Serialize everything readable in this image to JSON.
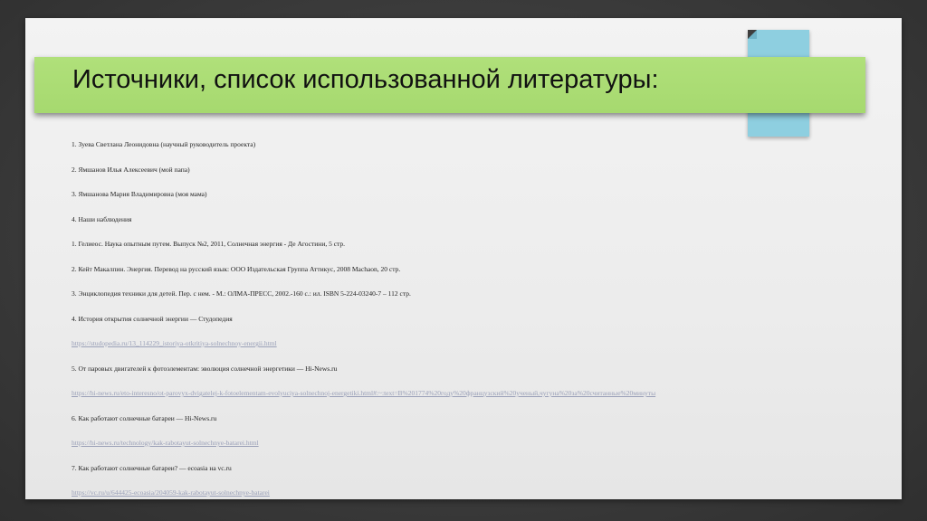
{
  "slide": {
    "title": "Источники, список использованной литературы:",
    "references": [
      {
        "text": "1. Зуева Светлана Леонидовна (научный руководитель проекта)",
        "kind": "text"
      },
      {
        "text": "2. Ямшанов Илья Алексеевич (мой папа)",
        "kind": "text"
      },
      {
        "text": "3. Ямшанова Мария Владимировна (моя мама)",
        "kind": "text"
      },
      {
        "text": "4. Наши наблюдения",
        "kind": "text"
      },
      {
        "text": "1. Гелиеос. Наука опытным путем. Выпуск №2, 2011, Солнечная энергия - Де Агостини, 5 стр.",
        "kind": "text"
      },
      {
        "text": "2. Кейт Макалпин. Энергия. Перевод на русский язык: ООО Издательская Группа Аттикус, 2008 Machaon, 20 стр.",
        "kind": "text"
      },
      {
        "text": "3. Энциклопедия техники для детей. Пер. с нем. - М.: ОЛМА-ПРЕСС, 2002.-160 с.: ил. ISBN 5-224-03240-7 – 112 стр.",
        "kind": "text"
      },
      {
        "text": "4. История открытия солнечной энергии — Студопедия",
        "kind": "text"
      },
      {
        "text": "https://studopedia.ru/13_114229_istoriya-otkritiya-solnechnoy-energii.html",
        "kind": "link"
      },
      {
        "text": "5. От паровых двигателей к фотоэлементам: эволюция солнечной энергетики — Hi-News.ru",
        "kind": "text"
      },
      {
        "text": "https://hi-news.ru/eto-interesno/ot-parovyx-dvigatelej-k-fotoelementam-evolyuciya-solnechnoj-energetiki.html#:~:text=B%201774%20году%20французский%20ученый,чугуна%20за%20считанные%20минуты",
        "kind": "link"
      },
      {
        "text": "6. Как работают солнечные батареи — Hi-News.ru",
        "kind": "text"
      },
      {
        "text": "https://hi-news.ru/technology/kak-rabotayut-solnechnye-batarei.html",
        "kind": "link"
      },
      {
        "text": "7. Как работают солнечные батареи? — ecoasia на vc.ru",
        "kind": "text"
      },
      {
        "text": "https://vc.ru/u/644425-ecoasia/204059-kak-rabotayut-solnechnye-batarei",
        "kind": "link"
      }
    ]
  },
  "colors": {
    "title_banner": "#a6d96f",
    "accent_tab": "#8ecfe0",
    "background": "#3e3e3e",
    "slide": "#eeeeee"
  }
}
